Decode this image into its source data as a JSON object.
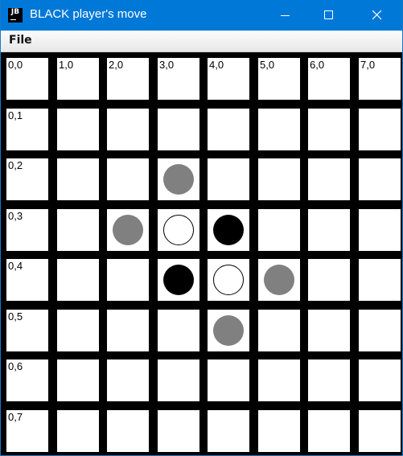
{
  "window": {
    "title": "BLACK player's move",
    "icon_text": "JB"
  },
  "menu": {
    "items": [
      "File"
    ]
  },
  "colors": {
    "titlebar": "#0078d7",
    "board_lines": "#000000",
    "black_piece": "#000000",
    "white_piece": "#ffffff",
    "move_hint": "#808080"
  },
  "board": {
    "cols": 8,
    "rows": 8,
    "col_labels": [
      "0,0",
      "1,0",
      "2,0",
      "3,0",
      "4,0",
      "5,0",
      "6,0",
      "7,0"
    ],
    "row_labels": [
      "0,1",
      "0,2",
      "0,3",
      "0,4",
      "0,5",
      "0,6",
      "0,7"
    ],
    "pieces": [
      {
        "col": 3,
        "row": 2,
        "kind": "hint"
      },
      {
        "col": 2,
        "row": 3,
        "kind": "hint"
      },
      {
        "col": 3,
        "row": 3,
        "kind": "white"
      },
      {
        "col": 4,
        "row": 3,
        "kind": "black"
      },
      {
        "col": 3,
        "row": 4,
        "kind": "black"
      },
      {
        "col": 4,
        "row": 4,
        "kind": "white"
      },
      {
        "col": 5,
        "row": 4,
        "kind": "hint"
      },
      {
        "col": 4,
        "row": 5,
        "kind": "hint"
      }
    ]
  }
}
